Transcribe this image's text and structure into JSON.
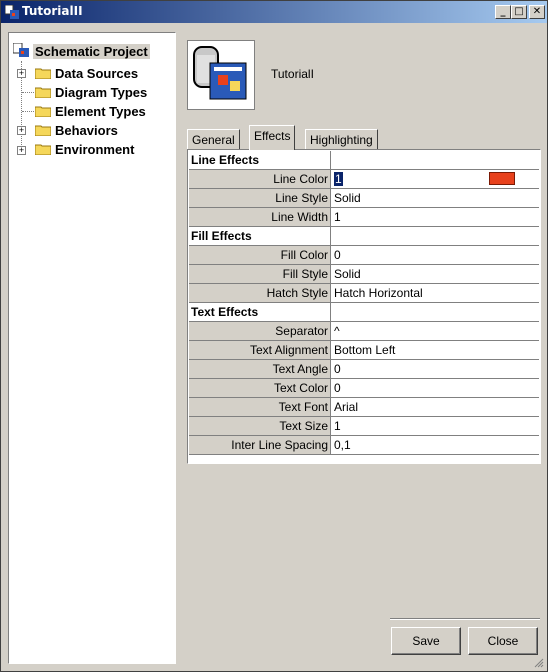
{
  "window": {
    "title": "TutorialII"
  },
  "titlebar": {
    "minimize": "_",
    "maximize": "□",
    "close": "✕"
  },
  "tree": {
    "root": "Schematic Project",
    "items": [
      {
        "label": "Data Sources",
        "expandable": true
      },
      {
        "label": "Diagram Types",
        "expandable": false
      },
      {
        "label": "Element Types",
        "expandable": false
      },
      {
        "label": "Behaviors",
        "expandable": true
      },
      {
        "label": "Environment",
        "expandable": true
      }
    ]
  },
  "header": {
    "title": "TutorialI"
  },
  "tabs": {
    "general": "General",
    "effects": "Effects",
    "highlighting": "Highlighting"
  },
  "properties": {
    "line_effects": "Line Effects",
    "line_color": {
      "label": "Line Color",
      "value": "1",
      "swatch": "#e8411c"
    },
    "line_style": {
      "label": "Line Style",
      "value": "Solid"
    },
    "line_width": {
      "label": "Line Width",
      "value": "1"
    },
    "fill_effects": "Fill Effects",
    "fill_color": {
      "label": "Fill Color",
      "value": "0"
    },
    "fill_style": {
      "label": "Fill Style",
      "value": "Solid"
    },
    "hatch_style": {
      "label": "Hatch Style",
      "value": "Hatch Horizontal"
    },
    "text_effects": "Text Effects",
    "separator": {
      "label": "Separator",
      "value": "^"
    },
    "text_alignment": {
      "label": "Text Alignment",
      "value": "Bottom Left"
    },
    "text_angle": {
      "label": "Text Angle",
      "value": "0"
    },
    "text_color": {
      "label": "Text Color",
      "value": "0"
    },
    "text_font": {
      "label": "Text Font",
      "value": "Arial"
    },
    "text_size": {
      "label": "Text Size",
      "value": "1"
    },
    "inter_line_spacing": {
      "label": "Inter Line Spacing",
      "value": "0,1"
    }
  },
  "footer": {
    "save": "Save",
    "close": "Close"
  },
  "colors": {
    "titlebar_start": "#0a246a",
    "titlebar_end": "#a6caf0",
    "face": "#d4d0c8",
    "folder": "#f5d75a"
  }
}
